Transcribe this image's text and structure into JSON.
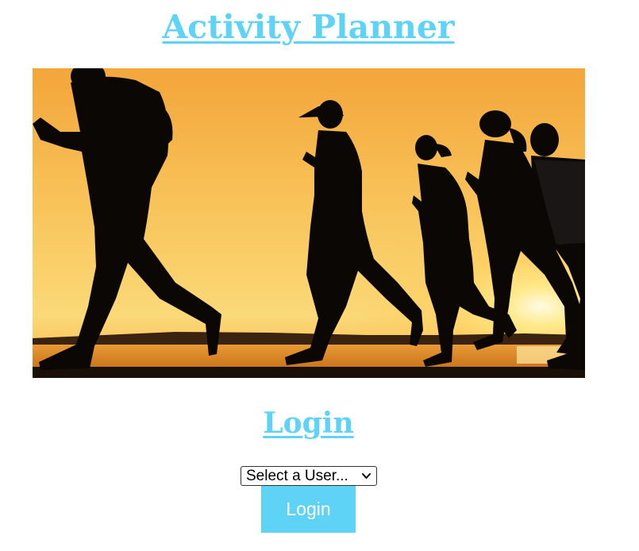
{
  "app": {
    "title": "Activity Planner"
  },
  "hero_image": {
    "description_icon": "runners-at-sunset-image"
  },
  "login": {
    "heading": "Login",
    "user_select": {
      "selected": "Select a User..."
    },
    "button_label": "Login"
  },
  "colors": {
    "accent": "#5fd3f5",
    "background": "#ffffff"
  }
}
